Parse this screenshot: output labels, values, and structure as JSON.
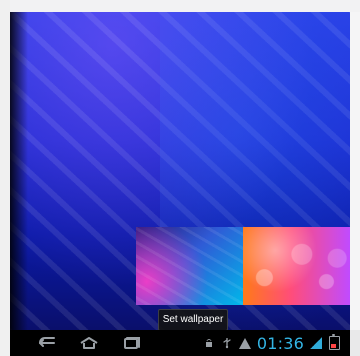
{
  "wallpaper_picker": {
    "action_label": "Set wallpaper"
  },
  "system_bar": {
    "time": "01:36",
    "status_icons": [
      "android-icon",
      "usb-icon",
      "warning-icon",
      "signal-icon",
      "battery-icon"
    ],
    "nav_icons": [
      "back-icon",
      "home-icon",
      "recent-apps-icon"
    ],
    "accent_color": "#33b5e5"
  }
}
